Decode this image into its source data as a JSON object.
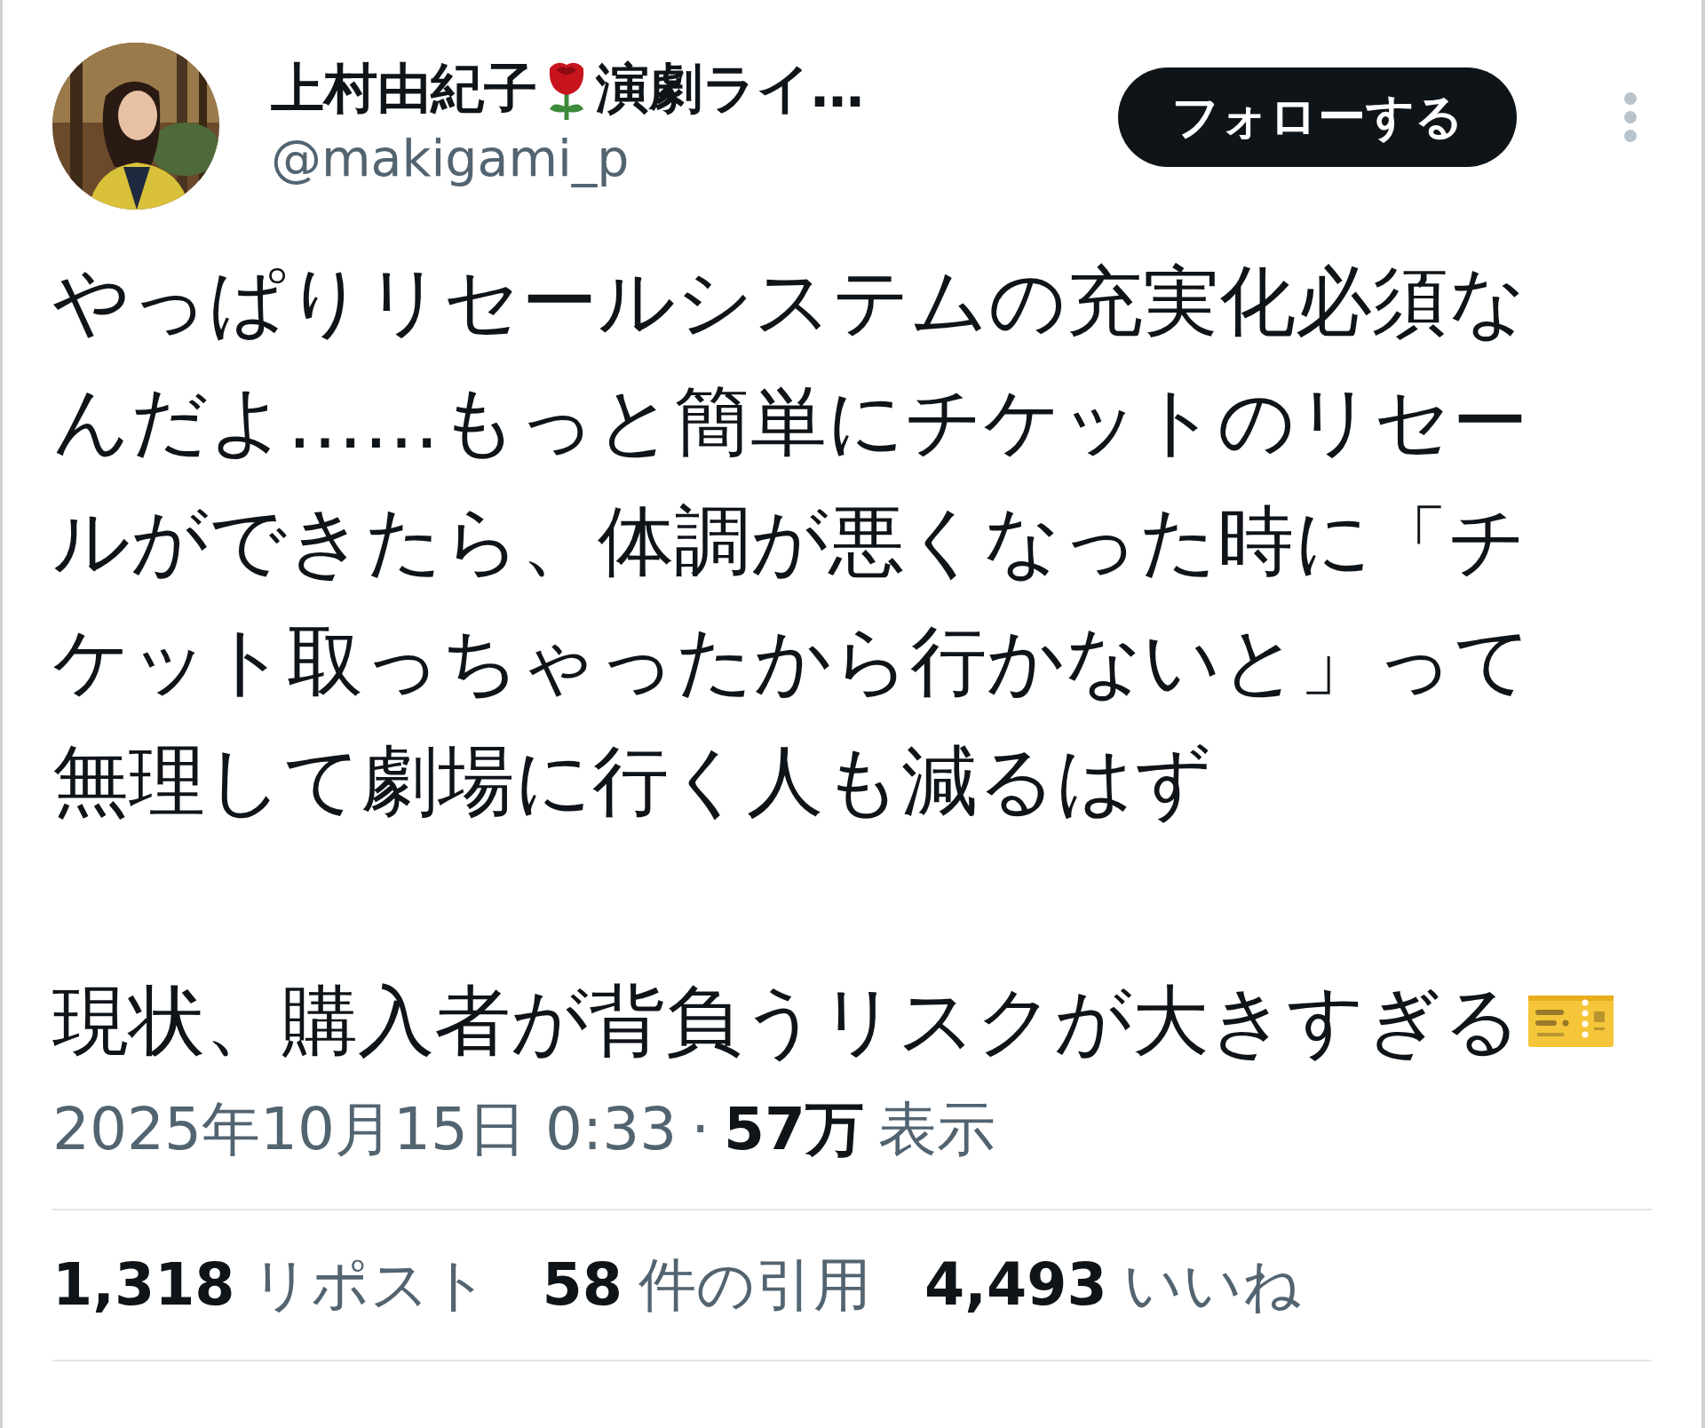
{
  "author": {
    "name_parts": [
      "上村由紀子",
      "演劇ライ…"
    ],
    "handle": "@makigami_p"
  },
  "follow_button": "フォローする",
  "body": {
    "paragraphs": [
      "やっぱりリセールシステムの充実化必須なんだよ……もっと簡単にチケットのリセールができたら、体調が悪くなった時に「チケット取っちゃったから行かないと」って無理して劇場に行く人も減るはず",
      "現状、購入者が背負うリスクが大きすぎる"
    ]
  },
  "meta": {
    "date": "2025年10月15日 0:33",
    "separator": "·",
    "views_count": "57万",
    "views_label": "表示"
  },
  "stats": [
    {
      "count": "1,318",
      "label": "リポスト"
    },
    {
      "count": "58",
      "label": "件の引用"
    },
    {
      "count": "4,493",
      "label": "いいね"
    }
  ]
}
